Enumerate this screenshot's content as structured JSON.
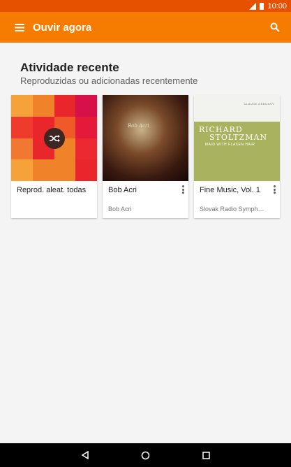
{
  "status": {
    "time": "10:00"
  },
  "app_bar": {
    "title": "Ouvir agora",
    "menu_icon": "menu-icon",
    "search_icon": "search-icon"
  },
  "section": {
    "title": "Atividade recente",
    "subtitle": "Reproduzidas ou adicionadas recentemente"
  },
  "cards": [
    {
      "title": "Reprod. aleat. todas",
      "subtitle": ""
    },
    {
      "title": "Bob Acri",
      "subtitle": "Bob Acri",
      "art_text": "Bob Acri"
    },
    {
      "title": "Fine Music, Vol. 1",
      "subtitle": "Slovak Radio Symph…",
      "art_line1": "RICHARD",
      "art_line2": "STOLTZMAN",
      "art_line3": "MAID WITH FLAXEN HAIR",
      "art_top": "CLAUDE DEBUSSY"
    }
  ],
  "colors": {
    "accent": "#f57c00",
    "status_bar": "#e65100"
  }
}
